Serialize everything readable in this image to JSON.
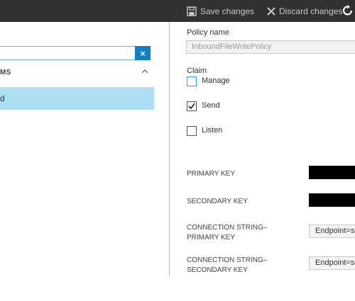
{
  "toolbar": {
    "save_label": "Save changes",
    "discard_label": "Discard changes",
    "icons": [
      "save-icon",
      "close-icon",
      "refresh-icon"
    ],
    "accent_color": "#0f7fc9"
  },
  "left_panel": {
    "search": {
      "value": "",
      "clear_symbol": "×"
    },
    "items_header": "MS",
    "selected_item": "d",
    "selected_color": "#ade0f3"
  },
  "policy": {
    "name_label": "Policy name",
    "name_value": "InboundFileWritePolicy",
    "claim_label": "Claim",
    "claims": [
      {
        "label": "Manage",
        "checked": false
      },
      {
        "label": "Send",
        "checked": true
      },
      {
        "label": "Listen",
        "checked": false
      }
    ],
    "primary_key_label": "PRIMARY KEY",
    "secondary_key_label": "SECONDARY KEY",
    "conn_primary_label_1": "CONNECTION STRING–",
    "conn_primary_label_2": "PRIMARY KEY",
    "conn_primary_value": "Endpoint=s",
    "conn_secondary_label_1": "CONNECTION STRING–",
    "conn_secondary_label_2": "SECONDARY KEY",
    "conn_secondary_value": "Endpoint=s"
  }
}
